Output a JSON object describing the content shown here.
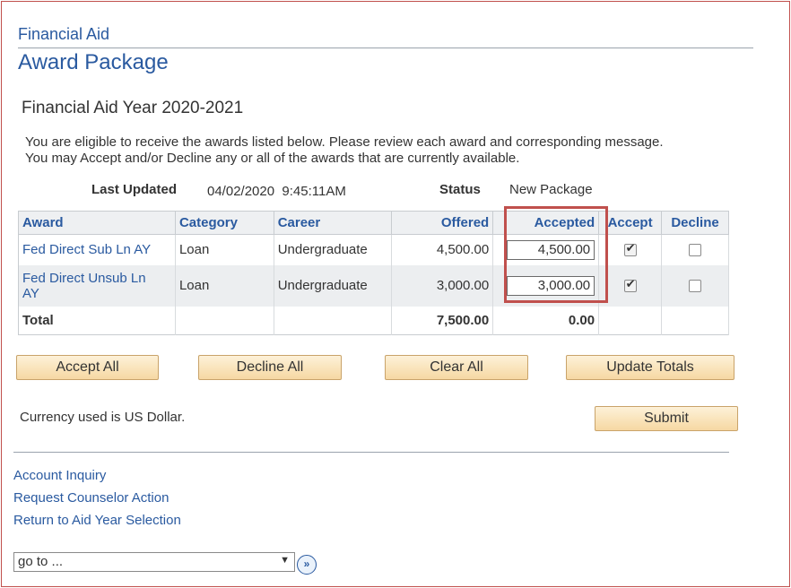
{
  "header": {
    "breadcrumb": "Financial Aid",
    "title": "Award Package"
  },
  "aid_year_heading": "Financial Aid Year 2020-2021",
  "instructions": {
    "line1": "You are eligible to receive the awards listed below. Please review each award and corresponding message.",
    "line2": "You may Accept and/or Decline any or all of the awards that are currently available."
  },
  "meta": {
    "last_updated_label": "Last Updated",
    "last_updated_value": "04/02/2020  9:45:11AM",
    "status_label": "Status",
    "status_value": "New Package"
  },
  "table": {
    "columns": [
      "Award",
      "Category",
      "Career",
      "Offered",
      "Accepted",
      "Accept",
      "Decline"
    ],
    "rows": [
      {
        "award": "Fed Direct Sub Ln AY",
        "category": "Loan",
        "career": "Undergraduate",
        "offered": "4,500.00",
        "accepted": "4,500.00",
        "accept_checked": true,
        "decline_checked": false
      },
      {
        "award": "Fed Direct Unsub Ln AY",
        "category": "Loan",
        "career": "Undergraduate",
        "offered": "3,000.00",
        "accepted": "3,000.00",
        "accept_checked": true,
        "decline_checked": false
      }
    ],
    "total": {
      "label": "Total",
      "offered": "7,500.00",
      "accepted": "0.00"
    }
  },
  "buttons": {
    "accept_all": "Accept All",
    "decline_all": "Decline All",
    "clear_all": "Clear All",
    "update_totals": "Update Totals",
    "submit": "Submit"
  },
  "currency_note": "Currency used is US Dollar.",
  "links": {
    "account_inquiry": "Account Inquiry",
    "request_counselor": "Request Counselor Action",
    "return_aid_year": "Return to Aid Year Selection"
  },
  "goto": {
    "value": "go to ...",
    "arrow": "▼",
    "go_symbol": "»"
  },
  "colors": {
    "link": "#2a5aa0",
    "highlight": "#c0504d",
    "button_bg": "#f6d8a3"
  }
}
